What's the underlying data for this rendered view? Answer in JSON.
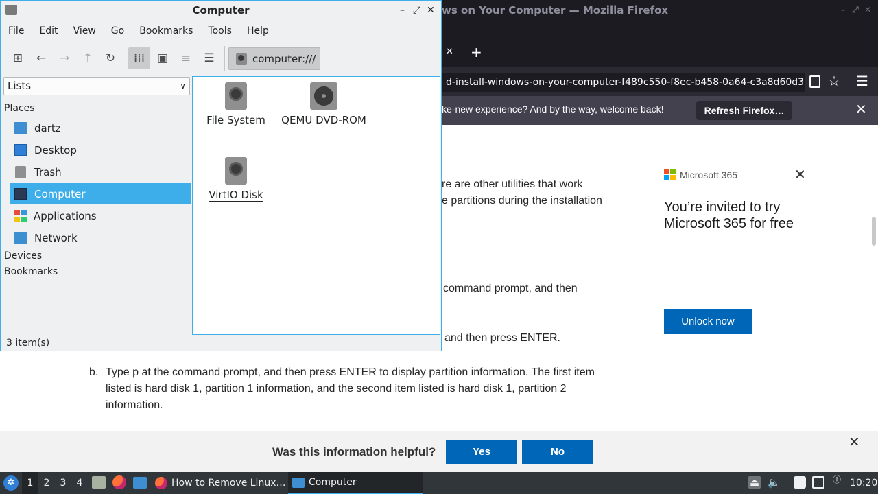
{
  "firefox": {
    "window_title": "ws on Your Computer — Mozilla Firefox",
    "url": "d-install-windows-on-your-computer-f489c550-f8ec-b458-0a64-c3a8d60d3",
    "notification_text": "ke-new experience? And by the way, welcome back!",
    "refresh_button": "Refresh Firefox…",
    "article": {
      "line1": "re are other utilities that work",
      "line2": "e partitions during the installation",
      "line3": "command prompt, and then",
      "line4": "and then press ENTER.",
      "step_b_marker": "b.",
      "step_b_line1": "Type p at the command prompt, and then press ENTER to display partition information. The first item",
      "step_b_line2": "listed is hard disk 1, partition 1 information, and the second item listed is hard disk 1, partition 2",
      "step_b_line3": "information."
    },
    "ad": {
      "brand": "Microsoft 365",
      "heading": "You’re invited to try Microsoft 365 for free",
      "button": "Unlock now"
    },
    "feedback": {
      "question": "Was this information helpful?",
      "yes": "Yes",
      "no": "No"
    }
  },
  "file_manager": {
    "title": "Computer",
    "menus": [
      "File",
      "Edit",
      "View",
      "Go",
      "Bookmarks",
      "Tools",
      "Help"
    ],
    "path": "computer:///",
    "side_mode": "Lists",
    "places_heading": "Places",
    "places": [
      {
        "label": "dartz",
        "icon": "home-folder-icon"
      },
      {
        "label": "Desktop",
        "icon": "desktop-icon"
      },
      {
        "label": "Trash",
        "icon": "trash-icon"
      },
      {
        "label": "Computer",
        "icon": "computer-icon"
      },
      {
        "label": "Applications",
        "icon": "applications-icon"
      },
      {
        "label": "Network",
        "icon": "network-icon"
      }
    ],
    "devices_heading": "Devices",
    "bookmarks_heading": "Bookmarks",
    "items": [
      {
        "label": "File System",
        "icon": "harddisk-icon"
      },
      {
        "label": "QEMU DVD-ROM",
        "icon": "optical-drive-icon"
      },
      {
        "label": "VirtIO Disk",
        "icon": "harddisk-icon"
      }
    ],
    "status": "3 item(s)"
  },
  "taskbar": {
    "workspaces": [
      "1",
      "2",
      "3",
      "4"
    ],
    "tasks": [
      {
        "label": "How to Remove Linux…",
        "icon": "firefox-icon"
      },
      {
        "label": "Computer",
        "icon": "folder-icon"
      }
    ],
    "clock": "10:20"
  },
  "colors": {
    "accent": "#3daee9",
    "ms_blue": "#0067b8"
  }
}
